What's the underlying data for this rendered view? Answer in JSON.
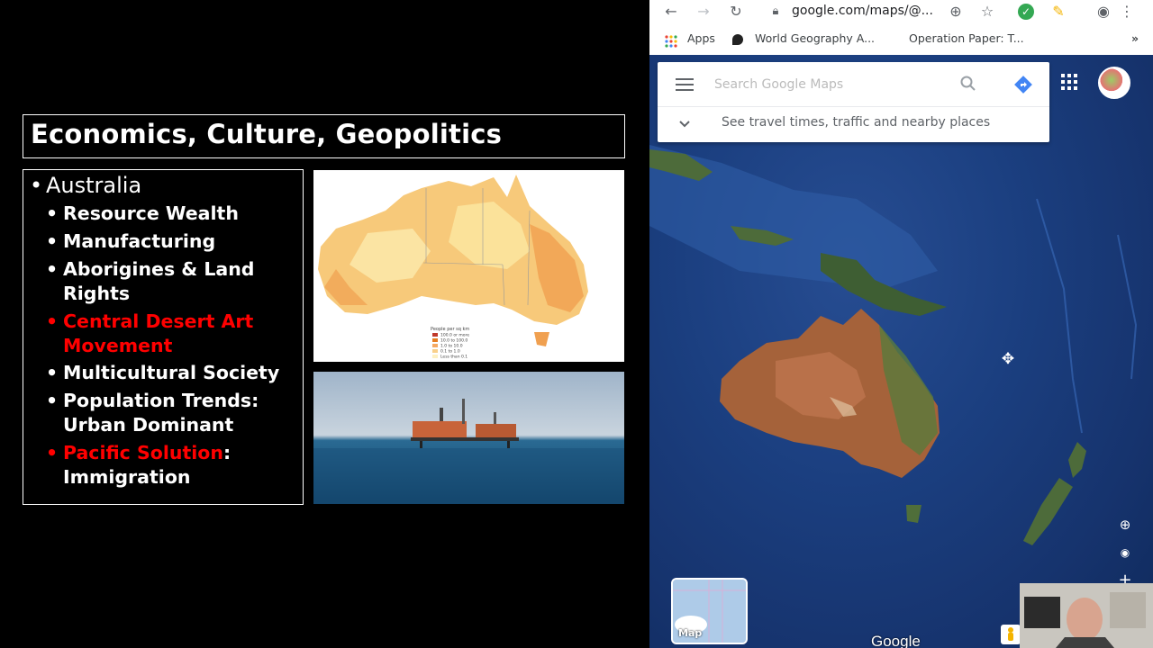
{
  "slide": {
    "title": "Economics, Culture, Geopolitics",
    "main_bullet": "Australia",
    "sub_bullets": [
      {
        "text": "Resource Wealth",
        "highlight": false
      },
      {
        "text": "Manufacturing",
        "highlight": false
      },
      {
        "text": "Aborigines & Land Rights",
        "highlight": false
      },
      {
        "text": "Central Desert Art Movement",
        "highlight": true
      },
      {
        "text": "Multicultural Society",
        "highlight": false
      },
      {
        "text": "Population Trends: Urban Dominant",
        "highlight": false
      },
      {
        "text": "Pacific Solution",
        "tail": ": Immigration",
        "highlight": true
      }
    ],
    "highlight_color": "#ff0000",
    "map_legend": {
      "title": "People per sq km",
      "rows": [
        "100.0 or more",
        "10.0 to 100.0",
        "1.0 to 10.0",
        "0.1 to 1.0",
        "Less than 0.1"
      ]
    }
  },
  "browser": {
    "url": "google.com/maps/@...",
    "bookmarks": {
      "apps": "Apps",
      "item1": "World Geography A...",
      "item2": "Operation Paper: T..."
    },
    "more": "»"
  },
  "maps": {
    "search_placeholder": "Search Google Maps",
    "travel_prompt": "See travel times, traffic and nearby places",
    "layer_label": "Map",
    "logo": "Google",
    "accent": "#4285f4"
  }
}
